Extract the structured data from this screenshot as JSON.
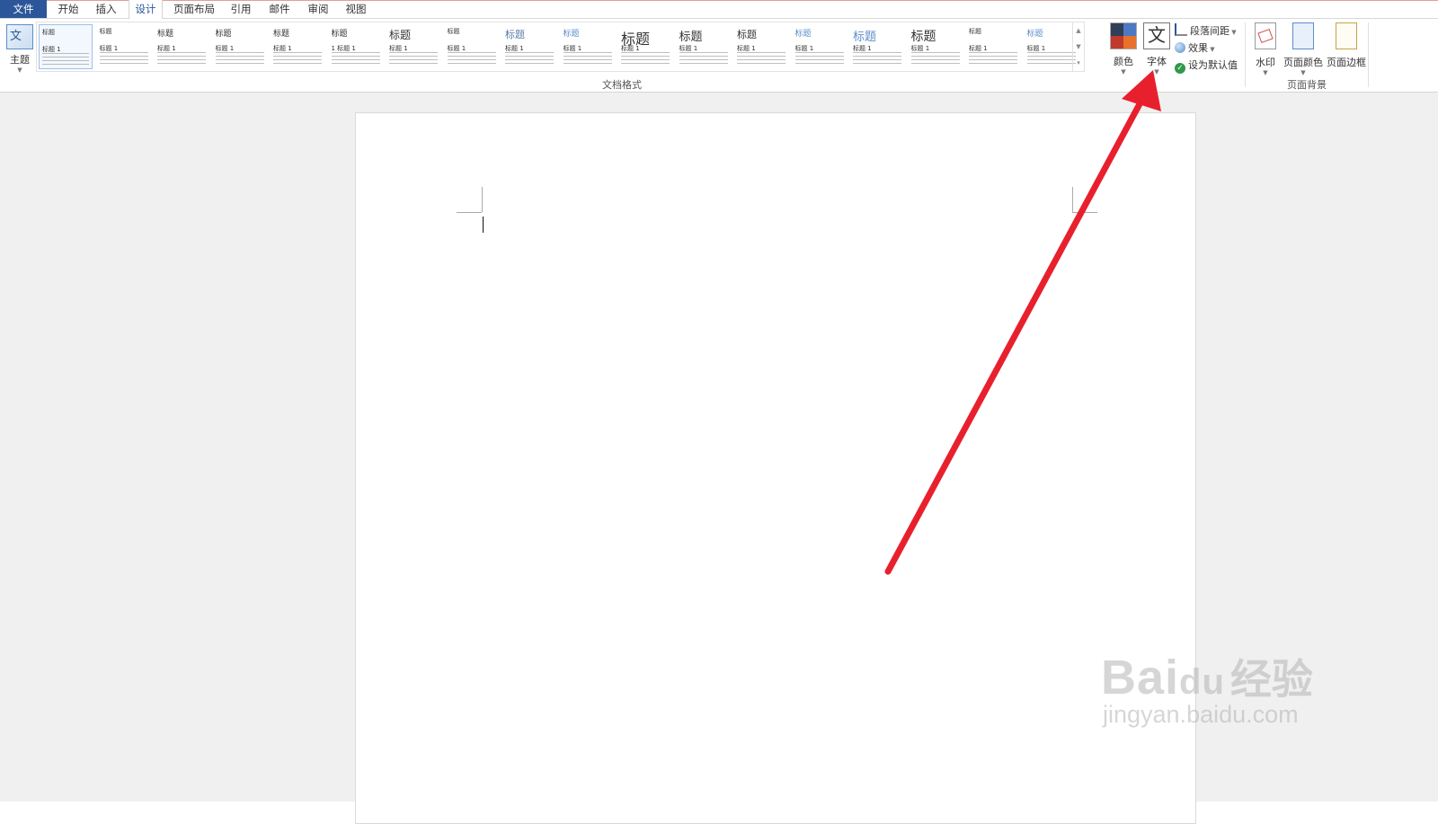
{
  "tabs": {
    "file": "文件",
    "home": "开始",
    "insert": "插入",
    "design": "设计",
    "layout": "页面布局",
    "references": "引用",
    "mailings": "邮件",
    "review": "审阅",
    "view": "视图"
  },
  "ribbon": {
    "theme_label": "主题",
    "theme_icon_glyph": "文",
    "style_set_group_label": "文档格式",
    "style_gallery": [
      {
        "title": "标题",
        "heading": "标题 1"
      },
      {
        "title": "标题",
        "heading": "标题 1"
      },
      {
        "title": "标题",
        "heading": "标题 1"
      },
      {
        "title": "标题",
        "heading": "标题 1"
      },
      {
        "title": "标题",
        "heading": "标题 1"
      },
      {
        "title": "标题",
        "heading": "1  标题 1"
      },
      {
        "title": "标题",
        "heading": "标题 1"
      },
      {
        "title": "标题",
        "heading": "标题 1"
      },
      {
        "title": "标题",
        "heading": "标题 1"
      },
      {
        "title": "标题",
        "heading": "标题 1"
      },
      {
        "title": "标题",
        "heading": "标题 1"
      },
      {
        "title": "标题",
        "heading": "标题 1"
      },
      {
        "title": "标题",
        "heading": "标题 1"
      },
      {
        "title": "标题",
        "heading": "标题 1"
      },
      {
        "title": "标题",
        "heading": "标题 1"
      },
      {
        "title": "标题",
        "heading": "标题 1"
      },
      {
        "title": "标题",
        "heading": "标题 1"
      },
      {
        "title": "标题",
        "heading": "标题 1"
      }
    ],
    "colors_label": "颜色",
    "fonts_label": "字体",
    "fonts_icon_glyph": "文",
    "paragraph_spacing_label": "段落间距",
    "effects_label": "效果",
    "set_default_label": "设为默认值",
    "watermark_label": "水印",
    "page_color_label": "页面颜色",
    "page_borders_label": "页面边框",
    "page_background_group_label": "页面背景"
  },
  "colors": {
    "accent_blue": "#2b579a",
    "annotation_red": "#e8202e"
  },
  "watermark": {
    "logo_text": "Bai",
    "logo_paw": "du",
    "logo_cn": "经验",
    "url": "jingyan.baidu.com"
  }
}
